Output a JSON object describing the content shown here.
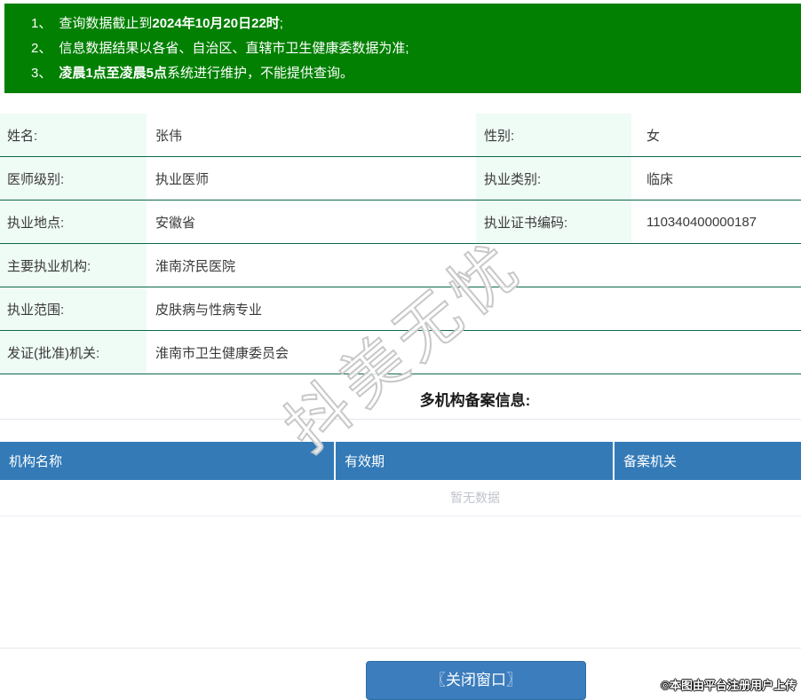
{
  "banner": {
    "bg_color": "#018001",
    "notices": [
      {
        "num": "1、",
        "pre": "查询数据截止到",
        "bold": "2024年10月20日22时",
        "post": ";"
      },
      {
        "num": "2、",
        "pre": "信息数据结果以各省、自治区、直辖市卫生健康委数据为准;",
        "bold": "",
        "post": ""
      },
      {
        "num": "3、",
        "pre": "",
        "bold": "凌晨1点至凌晨5点",
        "post": "系统进行维护，不能提供查询。"
      }
    ]
  },
  "info": {
    "border_color": "#0c6a4d",
    "label_bg_color": "#effbf5",
    "rows": [
      {
        "label": "姓名:",
        "value": "张伟",
        "label2": "性别:",
        "value2": "女"
      },
      {
        "label": "医师级别:",
        "value": "执业医师",
        "label2": "执业类别:",
        "value2": "临床"
      },
      {
        "label": "执业地点:",
        "value": "安徽省",
        "label2": "执业证书编码:",
        "value2": "110340400000187"
      },
      {
        "label": "主要执业机构:",
        "value": "淮南济民医院"
      },
      {
        "label": "执业范围:",
        "value": "皮肤病与性病专业"
      },
      {
        "label": "发证(批准)机关:",
        "value": "淮南市卫生健康委员会"
      }
    ]
  },
  "filing_section": {
    "title": "多机构备案信息:",
    "header_bg_color": "#337ab7",
    "headers": [
      "机构名称",
      "有效期",
      "备案机关"
    ],
    "empty_text": "暂无数据"
  },
  "watermark_text": "抖美无忧",
  "footer": {
    "close_button_label": "〖关闭窗口〗",
    "close_button_bg_color": "#3c7dbd",
    "copyright": "©本图由平台注册用户上传"
  }
}
